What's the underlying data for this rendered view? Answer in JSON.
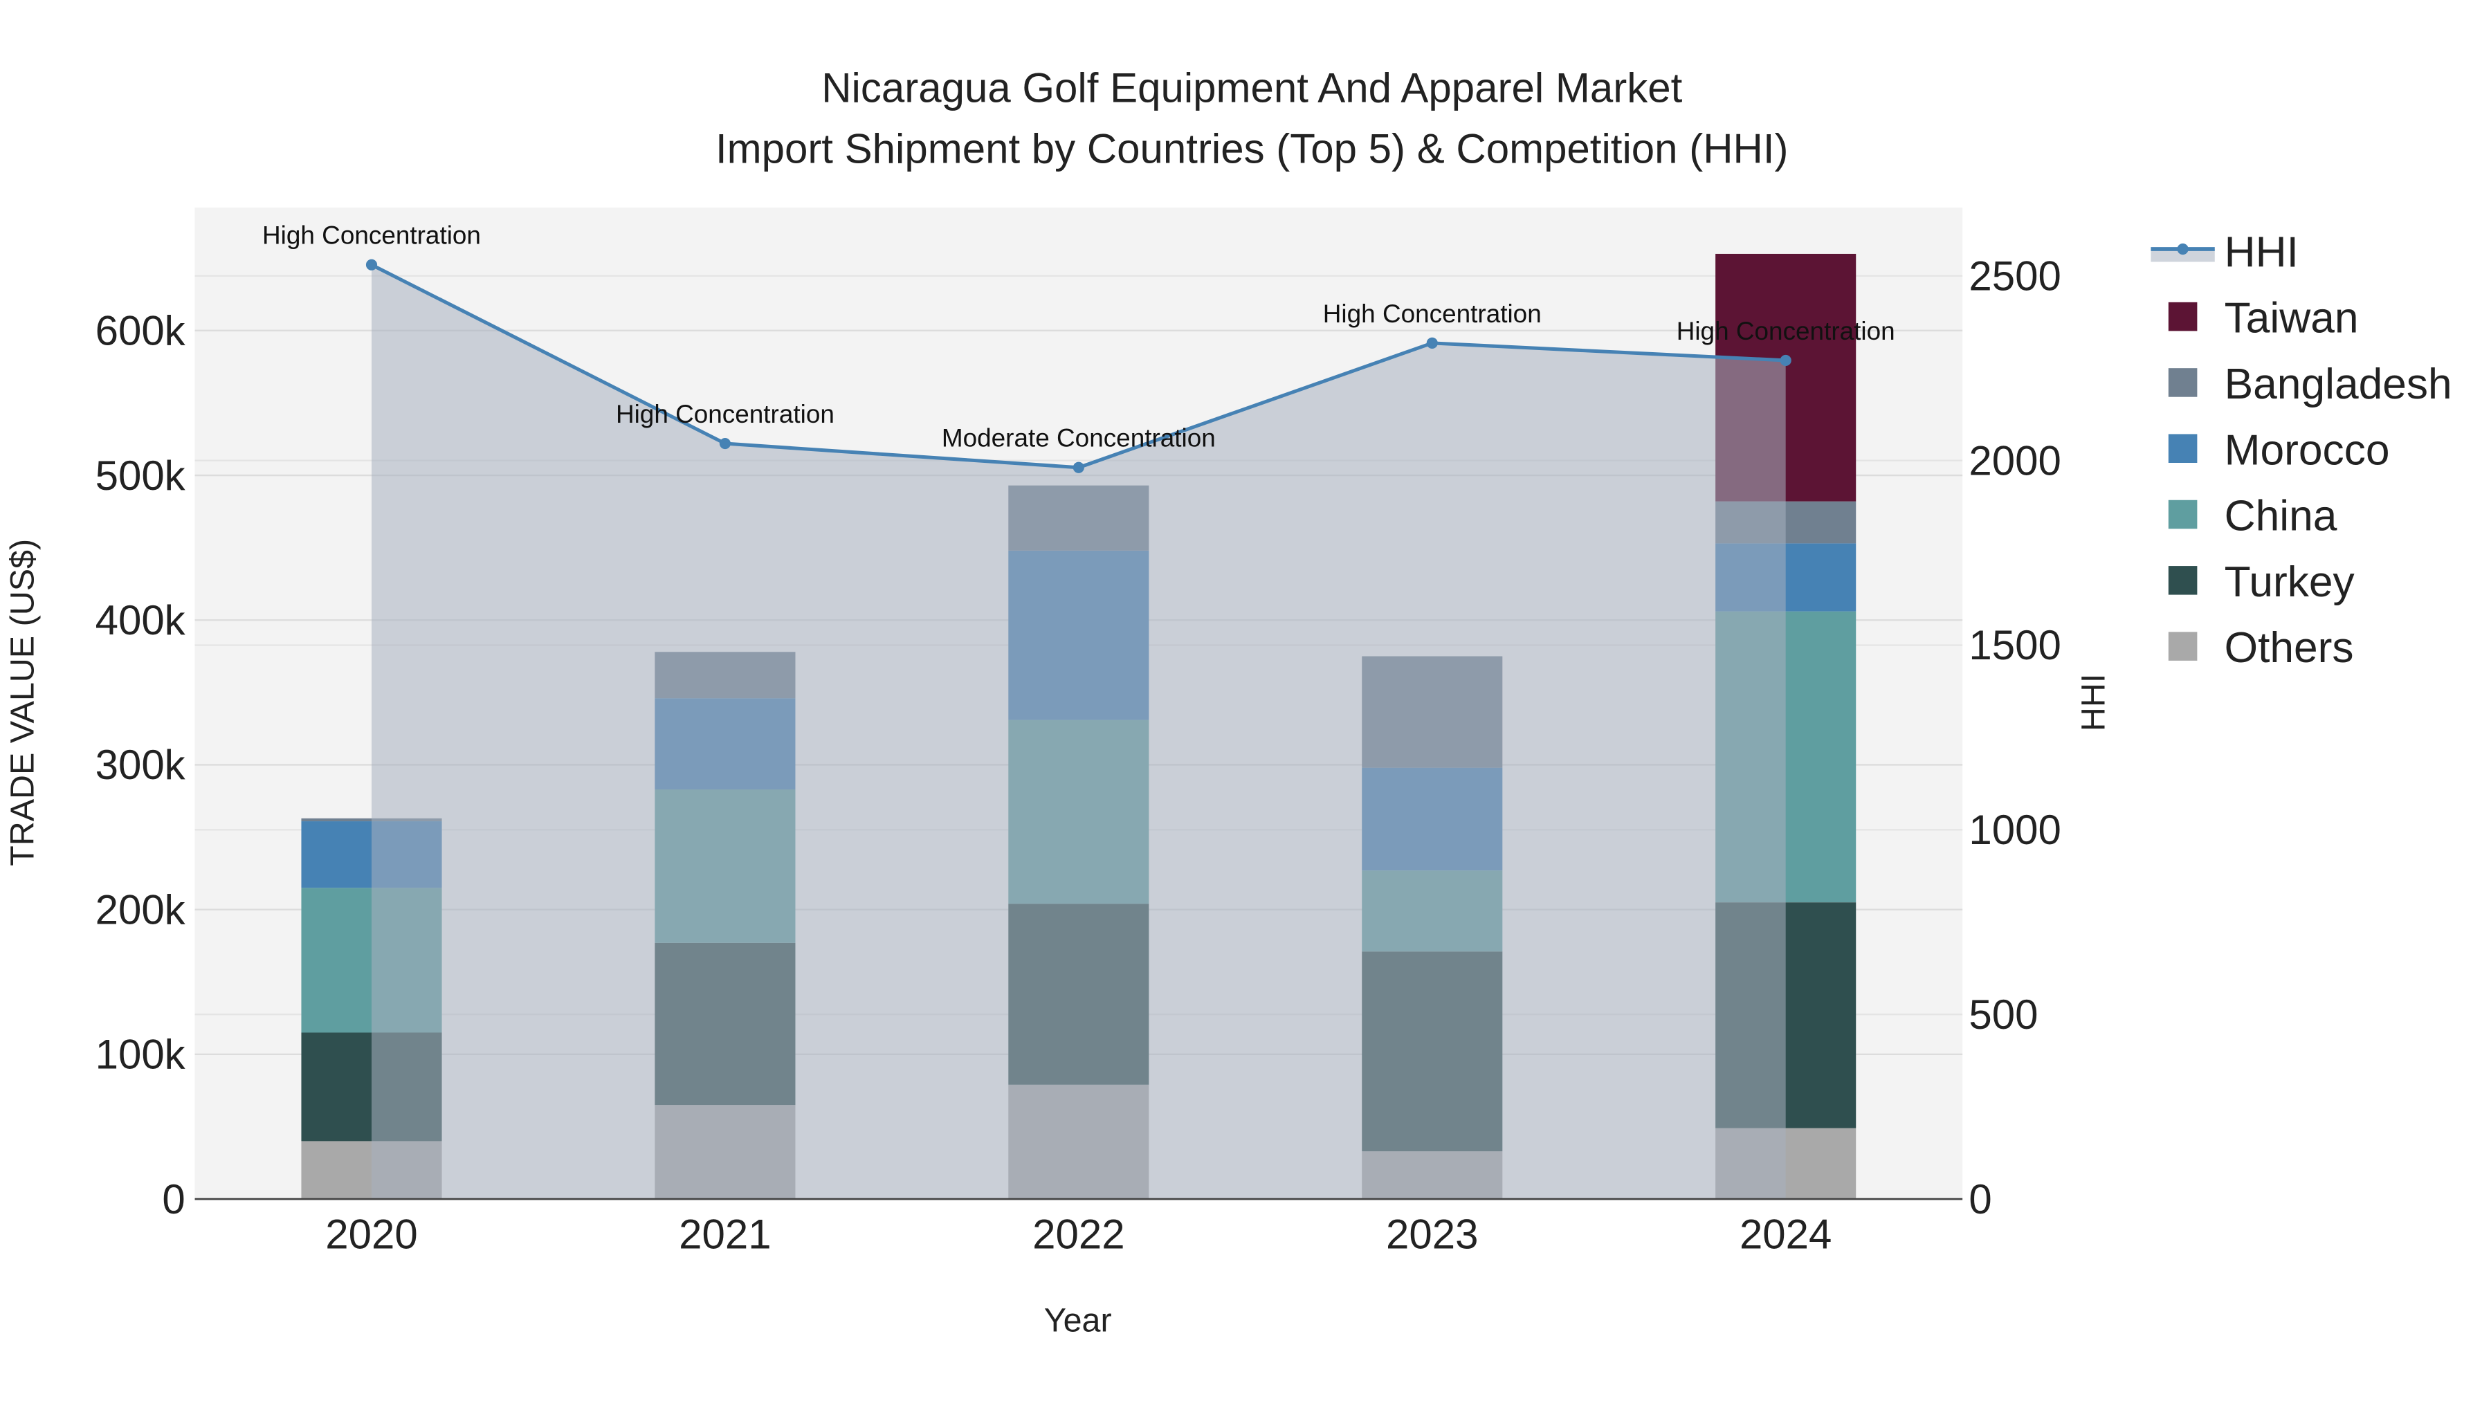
{
  "chart_data": {
    "type": "bar",
    "title_line1": "Nicaragua Golf Equipment And Apparel Market",
    "title_line2": "Import Shipment by Countries (Top 5) & Competition (HHI)",
    "xlabel": "Year",
    "ylabel": "TRADE VALUE (US$)",
    "y2label": "HHI",
    "categories": [
      "2020",
      "2021",
      "2022",
      "2023",
      "2024"
    ],
    "ylim": [
      0,
      685000
    ],
    "y2lim": [
      0,
      2685
    ],
    "yticks": [
      0,
      100000,
      200000,
      300000,
      400000,
      500000,
      600000
    ],
    "ytick_labels": [
      "0",
      "100k",
      "200k",
      "300k",
      "400k",
      "500k",
      "600k"
    ],
    "y2ticks": [
      0,
      500,
      1000,
      1500,
      2000,
      2500
    ],
    "y2tick_labels": [
      "0",
      "500",
      "1000",
      "1500",
      "2000",
      "2500"
    ],
    "series": [
      {
        "name": "Others",
        "color": "#a9a9a9",
        "values": [
          40000,
          65000,
          79000,
          33000,
          49000
        ]
      },
      {
        "name": "Turkey",
        "color": "#2f4f4f",
        "values": [
          75000,
          112000,
          125000,
          138000,
          156000
        ]
      },
      {
        "name": "China",
        "color": "#5f9ea0",
        "values": [
          100000,
          106000,
          127000,
          56000,
          201000
        ]
      },
      {
        "name": "Morocco",
        "color": "#4682b4",
        "values": [
          46000,
          63000,
          117000,
          71000,
          47000
        ]
      },
      {
        "name": "Bangladesh",
        "color": "#708090",
        "values": [
          2000,
          32000,
          45000,
          77000,
          29000
        ]
      },
      {
        "name": "Taiwan",
        "color": "#5c1434",
        "values": [
          0,
          0,
          0,
          0,
          171000
        ]
      }
    ],
    "hhi": {
      "name": "HHI",
      "color": "#4682b4",
      "values": [
        2530,
        2046,
        1981,
        2318,
        2271
      ],
      "annotations": [
        "High Concentration",
        "High Concentration",
        "Moderate Concentration",
        "High Concentration",
        "High Concentration"
      ]
    },
    "legend": [
      "HHI",
      "Taiwan",
      "Bangladesh",
      "Morocco",
      "China",
      "Turkey",
      "Others"
    ],
    "legend_position": "right",
    "grid": true
  }
}
